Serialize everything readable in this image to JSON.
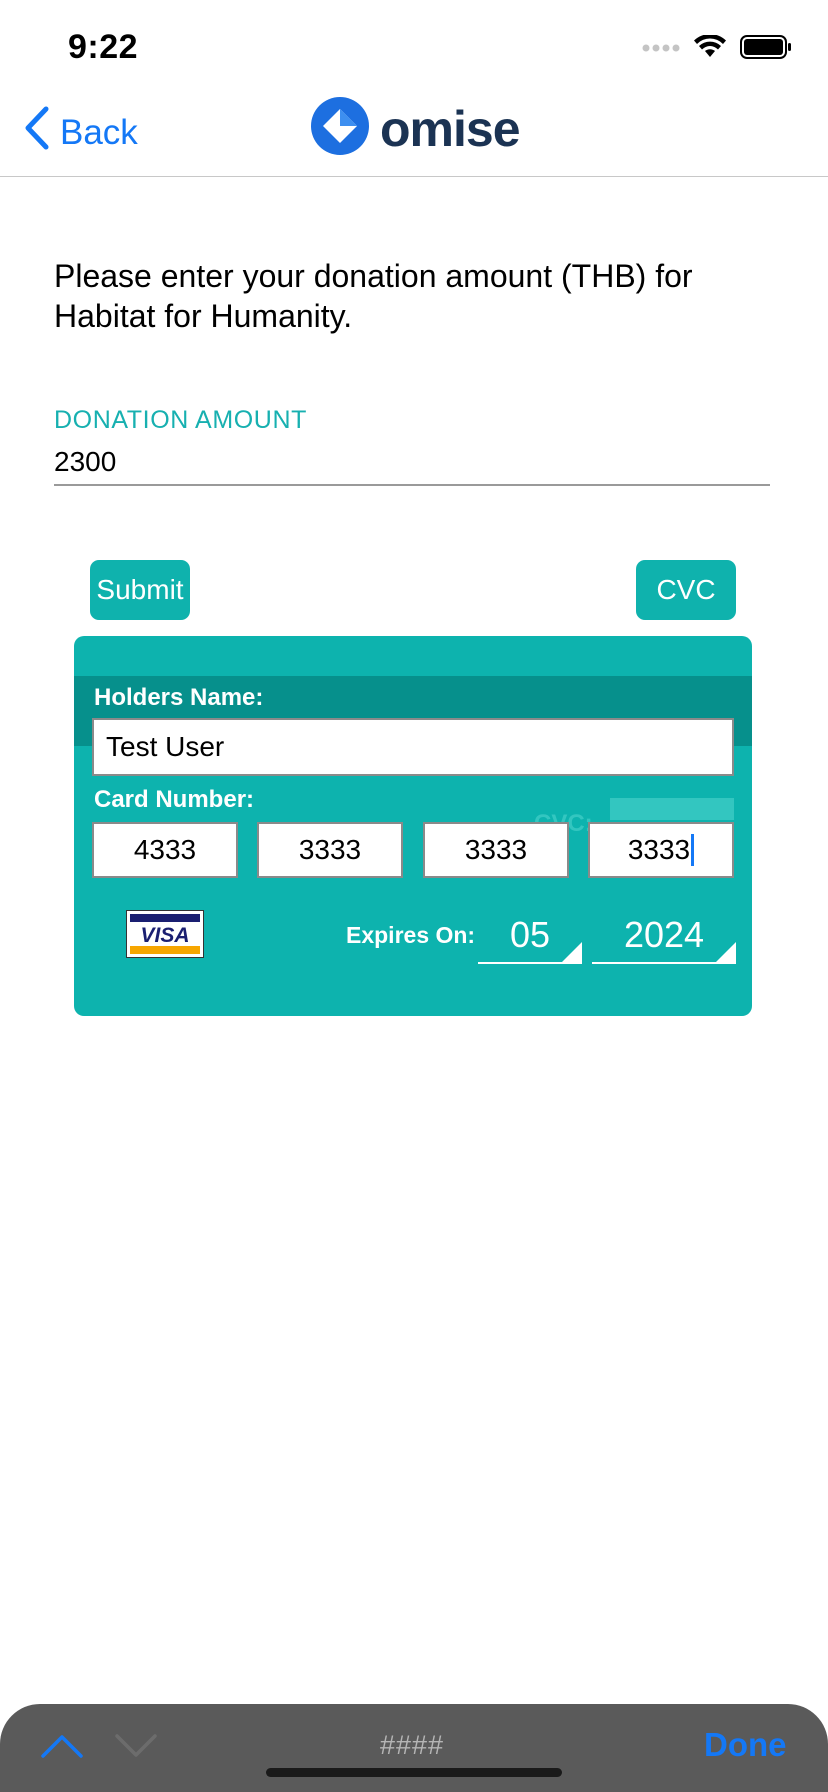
{
  "status_bar": {
    "time": "9:22",
    "icons": [
      "signal-icon",
      "wifi-icon",
      "battery-icon"
    ]
  },
  "nav": {
    "back_label": "Back",
    "logo_text": "omise"
  },
  "content": {
    "intro": "Please enter your donation amount (THB) for Habitat for Humanity.",
    "amount_label": "DONATION AMOUNT",
    "amount_value": "2300"
  },
  "buttons": {
    "submit": "Submit",
    "cvc": "CVC"
  },
  "card": {
    "holder_label": "Holders Name:",
    "holder_value": "Test User",
    "number_label": "Card Number:",
    "ghost_cvc": "CVC:",
    "numbers": [
      "4333",
      "3333",
      "3333",
      "3333"
    ],
    "brand": "VISA",
    "expires_label": "Expires On:",
    "exp_month": "05",
    "exp_year": "2024"
  },
  "keyboard_toolbar": {
    "mask": "####",
    "done": "Done"
  },
  "colors": {
    "accent": "#0fb2ad",
    "band": "#06908c",
    "link": "#1478f6",
    "logo": "#1b3353"
  }
}
